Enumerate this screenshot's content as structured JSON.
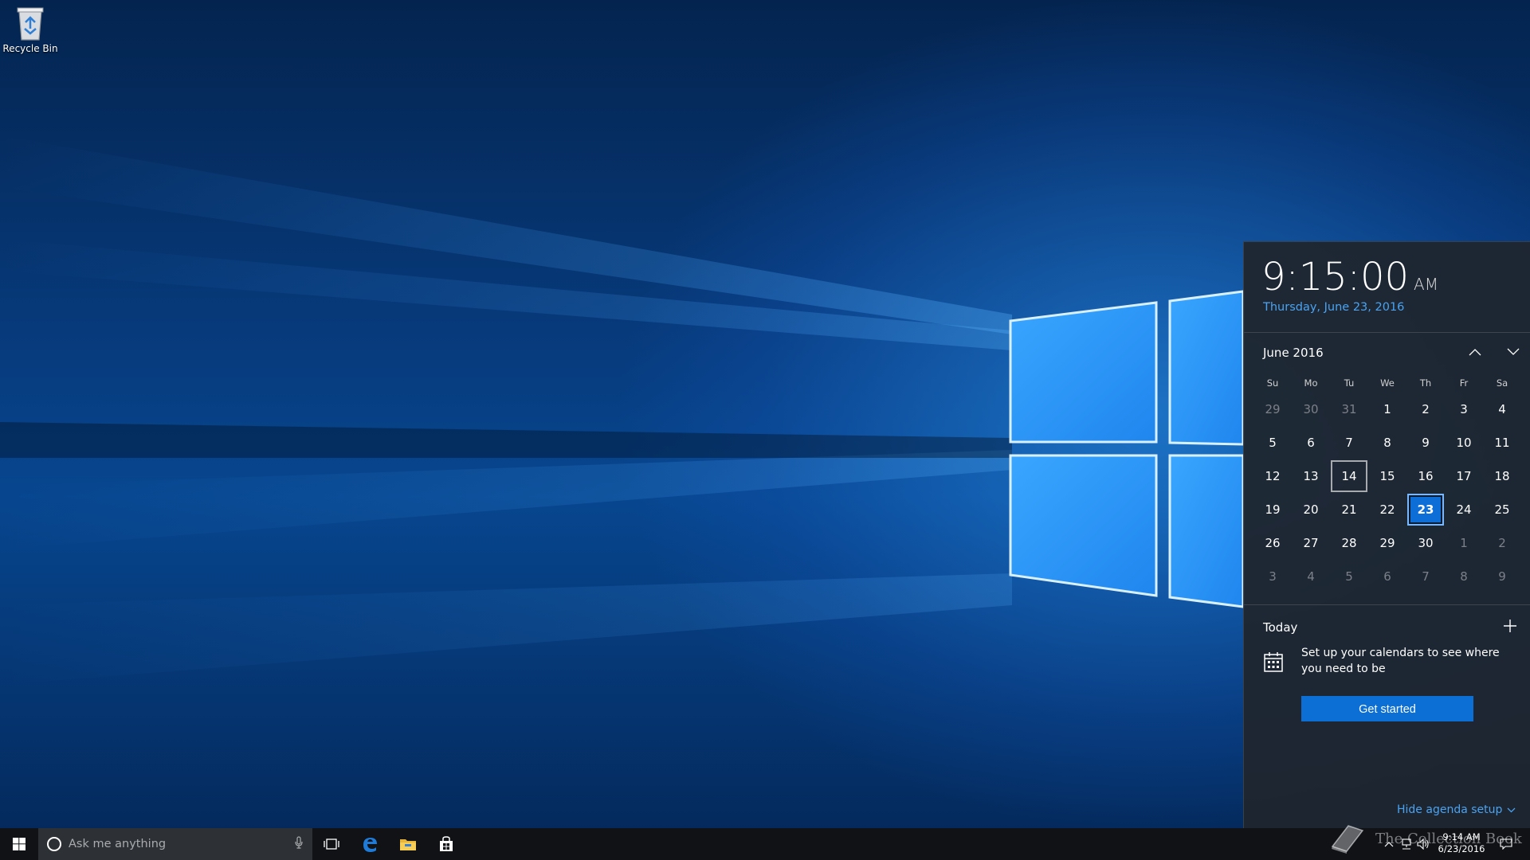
{
  "desktop": {
    "recycle_bin_label": "Recycle Bin"
  },
  "flyout": {
    "time": "9:15:00",
    "ampm": "AM",
    "long_date": "Thursday, June 23, 2016",
    "month_label": "June 2016",
    "weekdays": [
      "Su",
      "Mo",
      "Tu",
      "We",
      "Th",
      "Fr",
      "Sa"
    ],
    "weeks": [
      [
        {
          "d": "29",
          "o": true
        },
        {
          "d": "30",
          "o": true
        },
        {
          "d": "31",
          "o": true
        },
        {
          "d": "1"
        },
        {
          "d": "2"
        },
        {
          "d": "3"
        },
        {
          "d": "4"
        }
      ],
      [
        {
          "d": "5"
        },
        {
          "d": "6"
        },
        {
          "d": "7"
        },
        {
          "d": "8"
        },
        {
          "d": "9"
        },
        {
          "d": "10"
        },
        {
          "d": "11"
        }
      ],
      [
        {
          "d": "12"
        },
        {
          "d": "13"
        },
        {
          "d": "14",
          "sel": true
        },
        {
          "d": "15"
        },
        {
          "d": "16"
        },
        {
          "d": "17"
        },
        {
          "d": "18"
        }
      ],
      [
        {
          "d": "19"
        },
        {
          "d": "20"
        },
        {
          "d": "21"
        },
        {
          "d": "22"
        },
        {
          "d": "23",
          "today": true
        },
        {
          "d": "24"
        },
        {
          "d": "25"
        }
      ],
      [
        {
          "d": "26"
        },
        {
          "d": "27"
        },
        {
          "d": "28"
        },
        {
          "d": "29"
        },
        {
          "d": "30"
        },
        {
          "d": "1",
          "o": true
        },
        {
          "d": "2",
          "o": true
        }
      ],
      [
        {
          "d": "3",
          "o": true
        },
        {
          "d": "4",
          "o": true
        },
        {
          "d": "5",
          "o": true
        },
        {
          "d": "6",
          "o": true
        },
        {
          "d": "7",
          "o": true
        },
        {
          "d": "8",
          "o": true
        },
        {
          "d": "9",
          "o": true
        }
      ]
    ],
    "today_label": "Today",
    "agenda_message": "Set up your calendars to see where you need to be",
    "get_started_label": "Get started",
    "hide_agenda_label": "Hide agenda setup"
  },
  "taskbar": {
    "search_placeholder": "Ask me anything",
    "clock_time": "9:14 AM",
    "clock_date": "6/23/2016",
    "pinned": [
      "task-view-icon",
      "edge-icon",
      "file-explorer-icon",
      "store-icon"
    ],
    "tray": [
      "chevron-up-icon",
      "network-icon",
      "volume-icon",
      "action-center-icon"
    ]
  },
  "watermark": "The Collection Book",
  "colors": {
    "accent": "#0b6fd6",
    "link": "#4aa3f0",
    "flyout_bg": "#1f252e",
    "taskbar_bg": "#101216"
  }
}
